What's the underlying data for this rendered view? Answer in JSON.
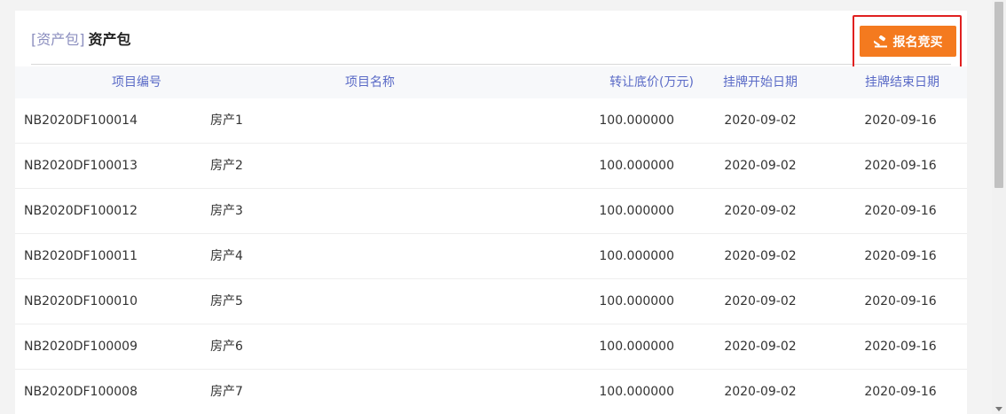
{
  "header": {
    "tag": "[资产包]",
    "title": "资产包",
    "buy_button_label": "报名竞买",
    "buy_button_icon": "gavel-icon"
  },
  "table": {
    "columns": [
      "项目编号",
      "项目名称",
      "转让底价(万元)",
      "挂牌开始日期",
      "挂牌结束日期"
    ],
    "rows": [
      [
        "NB2020DF100014",
        "房产1",
        "100.000000",
        "2020-09-02",
        "2020-09-16"
      ],
      [
        "NB2020DF100013",
        "房产2",
        "100.000000",
        "2020-09-02",
        "2020-09-16"
      ],
      [
        "NB2020DF100012",
        "房产3",
        "100.000000",
        "2020-09-02",
        "2020-09-16"
      ],
      [
        "NB2020DF100011",
        "房产4",
        "100.000000",
        "2020-09-02",
        "2020-09-16"
      ],
      [
        "NB2020DF100010",
        "房产5",
        "100.000000",
        "2020-09-02",
        "2020-09-16"
      ],
      [
        "NB2020DF100009",
        "房产6",
        "100.000000",
        "2020-09-02",
        "2020-09-16"
      ],
      [
        "NB2020DF100008",
        "房产7",
        "100.000000",
        "2020-09-02",
        "2020-09-16"
      ]
    ]
  },
  "colors": {
    "accent": "#f47a1f",
    "header_text": "#5b6bc7",
    "tag_text": "#8c8fbf",
    "highlight_border": "#e02020"
  }
}
